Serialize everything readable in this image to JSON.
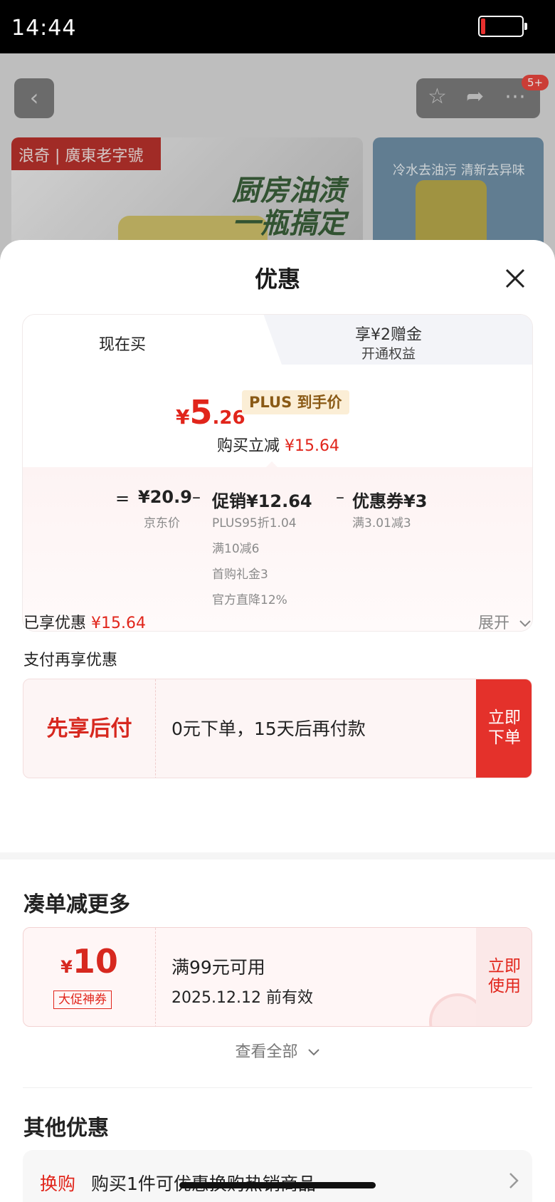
{
  "status_bar": {
    "time": "14:44"
  },
  "background_page": {
    "badge": "5+",
    "banner1_brand": "浪奇 | 廣東老字號",
    "banner1_slogan": "厨房油渍\n一瓶搞定",
    "banner2_text": "冷水去油污  清新去异味"
  },
  "sheet": {
    "title": "优惠",
    "tabs": {
      "active": "现在买",
      "alt_line1": "享¥2赠金",
      "alt_line2": "开通权益"
    },
    "final_price": {
      "currency": "¥",
      "integer": "5",
      "decimal": ".26"
    },
    "plus_tag": "PLUS 到手价",
    "reduce_label": "购买立减 ",
    "reduce_value": "¥15.64",
    "breakdown": {
      "equals": "=",
      "jd_price": "¥20.9",
      "jd_price_label": "京东价",
      "minus": "–",
      "promo": "促销¥12.64",
      "promo_items": [
        "PLUS95折1.04",
        "满10减6",
        "首购礼金3",
        "官方直降12%"
      ],
      "coupon": "优惠券¥3",
      "coupon_items": [
        "满3.01减3"
      ]
    },
    "enjoyed_label": "已享优惠 ",
    "enjoyed_value": "¥15.64",
    "expand_label": "展开",
    "pay_more_label": "支付再享优惠",
    "credit": {
      "title": "先享后付",
      "desc": "0元下单，15天后再付款",
      "cta_line1": "立即",
      "cta_line2": "下单"
    },
    "combo": {
      "title": "凑单减更多",
      "coupon_currency": "¥",
      "coupon_amount": "10",
      "coupon_tag": "大促神券",
      "condition": "满99元可用",
      "expiry": "2025.12.12 前有效",
      "cta_line1": "立即",
      "cta_line2": "使用",
      "view_all": "查看全部"
    },
    "other": {
      "title": "其他优惠",
      "row_label": "换购",
      "row_text": "购买1件可优惠换购热销商品"
    }
  },
  "colors": {
    "accent_red": "#e1251b",
    "cta_red": "#e4312b"
  }
}
